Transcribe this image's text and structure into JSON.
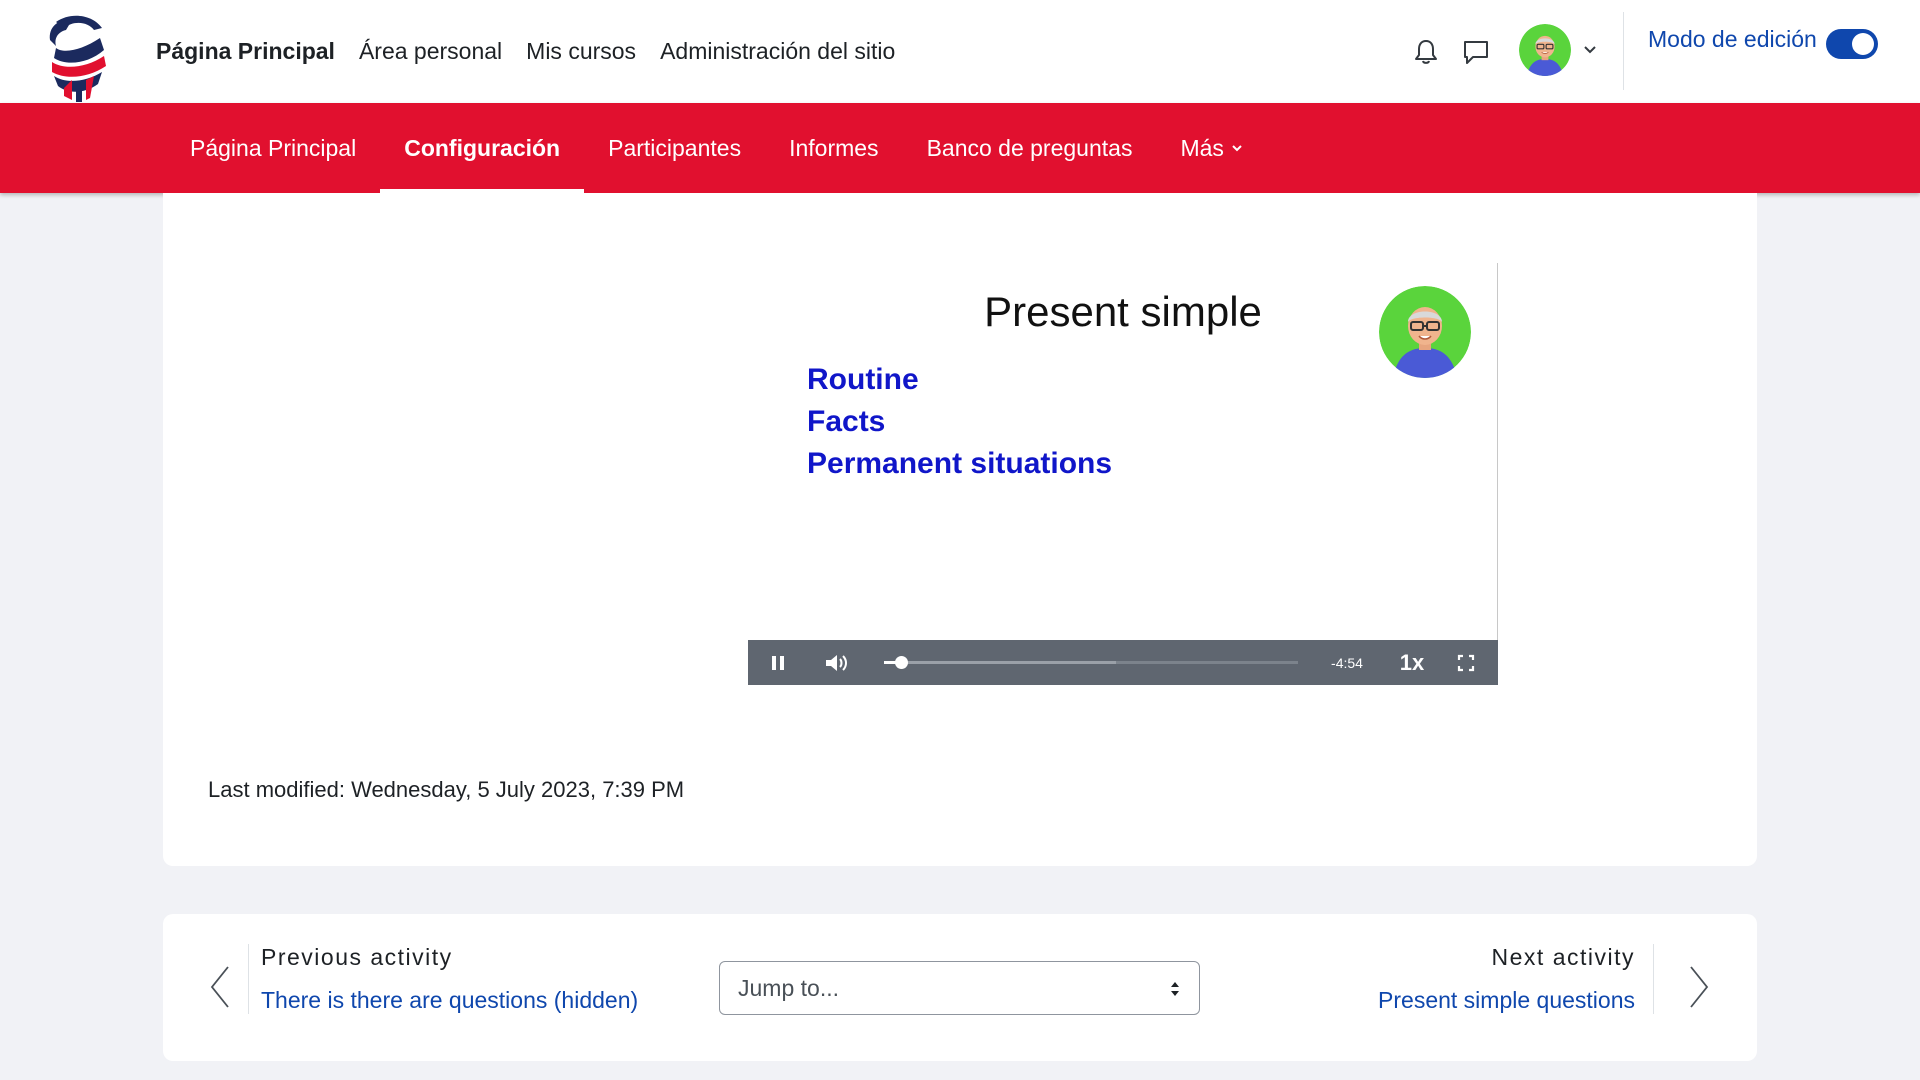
{
  "header": {
    "primary_nav": [
      {
        "label": "Página Principal",
        "active": true
      },
      {
        "label": "Área personal",
        "active": false
      },
      {
        "label": "Mis cursos",
        "active": false
      },
      {
        "label": "Administración del sitio",
        "active": false
      }
    ],
    "edit_mode_label": "Modo de edición",
    "edit_mode_on": true,
    "icons": [
      "bell-icon",
      "chat-icon",
      "user-avatar",
      "chevron-down-icon"
    ]
  },
  "secondary_nav": {
    "items": [
      {
        "label": "Página Principal",
        "active": false
      },
      {
        "label": "Configuración",
        "active": true
      },
      {
        "label": "Participantes",
        "active": false
      },
      {
        "label": "Informes",
        "active": false
      },
      {
        "label": "Banco de preguntas",
        "active": false
      },
      {
        "label": "Más",
        "active": false,
        "dropdown": true
      }
    ]
  },
  "video": {
    "slide_title": "Present simple",
    "bullets": [
      "Routine",
      "Facts",
      "Permanent situations"
    ],
    "time_remaining": "-4:54",
    "speed": "1x",
    "progress_fraction": 0.04,
    "buffered_fraction": 0.56
  },
  "main": {
    "last_modified": "Last modified: Wednesday, 5 July 2023, 7:39 PM"
  },
  "activity_nav": {
    "previous_caption": "Previous activity",
    "previous_link": "There is there are questions (hidden)",
    "jump_placeholder": "Jump to...",
    "next_caption": "Next activity",
    "next_link": "Present simple questions"
  },
  "colors": {
    "brand_red": "#e1102f",
    "link_blue": "#0f47ad",
    "bullet_blue": "#1016c9",
    "avatar_green": "#5ad43c"
  }
}
